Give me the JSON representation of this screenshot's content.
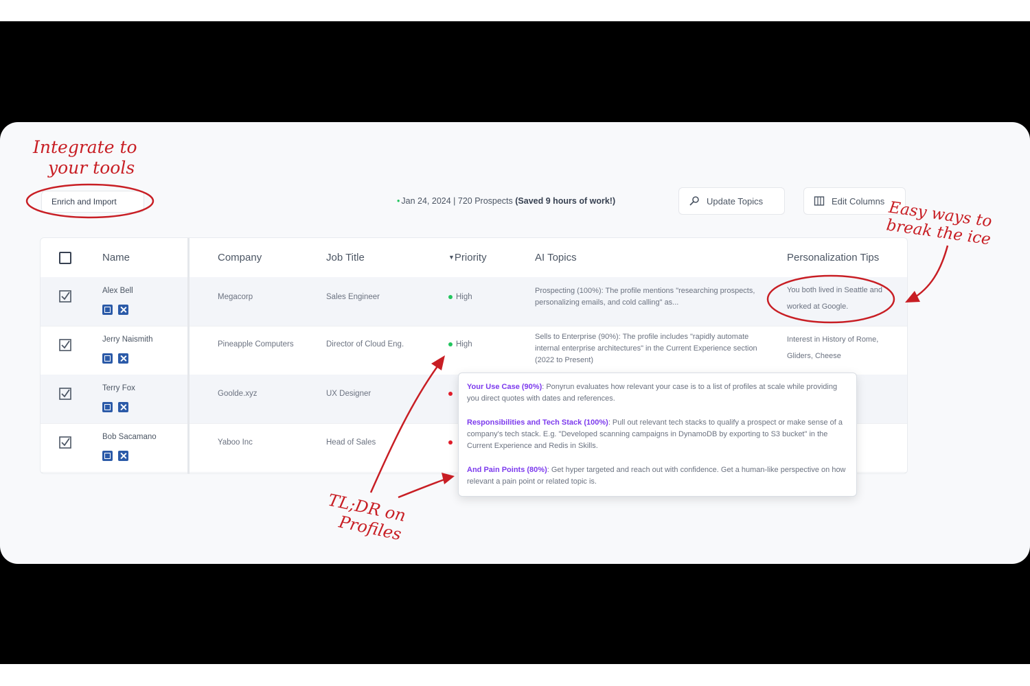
{
  "toolbar": {
    "enrich_label": "Enrich and Import",
    "meta_prefix": "Jan 24, 2024 | 720 Prospects",
    "meta_saved": "(Saved 9 hours of work!)",
    "update_topics_label": "Update Topics",
    "edit_columns_label": "Edit Columns"
  },
  "table": {
    "headers": {
      "name": "Name",
      "company": "Company",
      "job_title": "Job Title",
      "priority": "Priority",
      "ai_topics": "AI Topics",
      "tips": "Personalization Tips"
    },
    "rows": [
      {
        "name": "Alex Bell",
        "company": "Megacorp",
        "job": "Sales Engineer",
        "priority": "High",
        "topic": "Prospecting (100%): The profile mentions \"researching prospects, personalizing emails, and cold calling\" as...",
        "tip": "You both lived in Seattle and worked at Google."
      },
      {
        "name": "Jerry Naismith",
        "company": "Pineapple Computers",
        "job": "Director of Cloud Eng.",
        "priority": "High",
        "topic": "Sells to Enterprise (90%): The profile includes \"rapidly automate internal enterprise architectures\" in the Current Experience section (2022 to Present)",
        "tip": "Interest in History of Rome, Gliders, Cheese"
      },
      {
        "name": "Terry Fox",
        "company": "Goolde.xyz",
        "job": "UX Designer",
        "priority": "",
        "topic": "",
        "tip": ""
      },
      {
        "name": "Bob Sacamano",
        "company": "Yaboo Inc",
        "job": "Head of Sales",
        "priority": "",
        "topic": "",
        "tip": ""
      }
    ]
  },
  "popup": {
    "p1_title": "Your Use Case (90%)",
    "p1_text": ": Ponyrun evaluates how relevant your case is to a list of profiles at scale while providing you direct quotes with dates and references.",
    "p2_title": "Responsibilities and Tech Stack (100%)",
    "p2_text": ": Pull out relevant tech stacks to qualify a prospect or make sense of a company's tech stack. E.g. \"Developed scanning campaigns in DynamoDB by exporting to S3 bucket\" in the Current Experience and Redis in Skills.",
    "p3_title": "And Pain Points (80%)",
    "p3_text": ": Get hyper targeted and reach out with confidence. Get a human-like perspective on how relevant a pain point or related topic is."
  },
  "annotations": {
    "integrate_l1": "Integrate to",
    "integrate_l2": "your tools",
    "easy_l1": "Easy ways to",
    "easy_l2": "break the ice",
    "tldr_l1": "TL;DR on",
    "tldr_l2": "Profiles"
  },
  "colors": {
    "accent": "#7c3aed",
    "high": "#22c55e",
    "annotation": "#c81e24",
    "icon_blue": "#2b5aa8"
  }
}
